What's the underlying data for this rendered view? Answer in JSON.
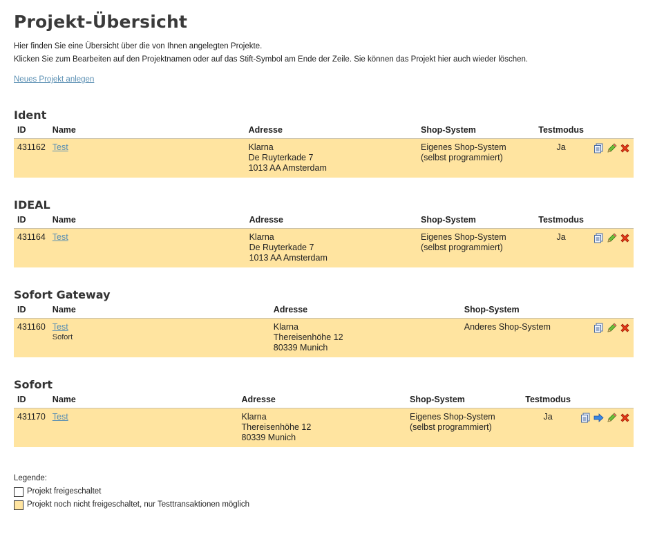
{
  "page": {
    "title": "Projekt-Übersicht",
    "intro_line1": "Hier finden Sie eine Übersicht über die von Ihnen angelegten Projekte.",
    "intro_line2": "Klicken Sie zum Bearbeiten auf den Projektnamen oder auf das Stift-Symbol am Ende der Zeile. Sie können das Projekt hier auch wieder löschen.",
    "new_project_link": "Neues Projekt anlegen"
  },
  "columns": {
    "id": "ID",
    "name": "Name",
    "address": "Adresse",
    "shop": "Shop-System",
    "testmode": "Testmodus"
  },
  "sections": [
    {
      "title": "Ident",
      "project": {
        "id": "431162",
        "name": "Test",
        "subname": "",
        "address": [
          "Klarna",
          "De Ruyterkade 7",
          "1013 AA Amsterdam"
        ],
        "shop": [
          "Eigenes Shop-System",
          "(selbst programmiert)"
        ],
        "testmode": "Ja"
      }
    },
    {
      "title": "IDEAL",
      "project": {
        "id": "431164",
        "name": "Test",
        "subname": "",
        "address": [
          "Klarna",
          "De Ruyterkade 7",
          "1013 AA Amsterdam"
        ],
        "shop": [
          "Eigenes Shop-System",
          "(selbst programmiert)"
        ],
        "testmode": "Ja"
      }
    },
    {
      "title": "Sofort Gateway",
      "project": {
        "id": "431160",
        "name": "Test",
        "subname": "Sofort",
        "address": [
          "Klarna",
          "Thereisenhöhe 12",
          "80339 Munich"
        ],
        "shop": [
          "Anderes Shop-System",
          ""
        ],
        "testmode": ""
      }
    },
    {
      "title": "Sofort",
      "project": {
        "id": "431170",
        "name": "Test",
        "subname": "",
        "address": [
          "Klarna",
          "Thereisenhöhe 12",
          "80339 Munich"
        ],
        "shop": [
          "Eigenes Shop-System",
          "(selbst programmiert)"
        ],
        "testmode": "Ja"
      }
    }
  ],
  "legend": {
    "title": "Legende:",
    "active": "Projekt freigeschaltet",
    "inactive": "Projekt noch nicht freigeschaltet, nur Testtransaktionen möglich"
  },
  "colors": {
    "row_bg": "#ffe4a0",
    "link": "#5a8fb3"
  },
  "icons": [
    "copy-icon",
    "arrow-right-icon",
    "pencil-icon",
    "delete-icon"
  ]
}
